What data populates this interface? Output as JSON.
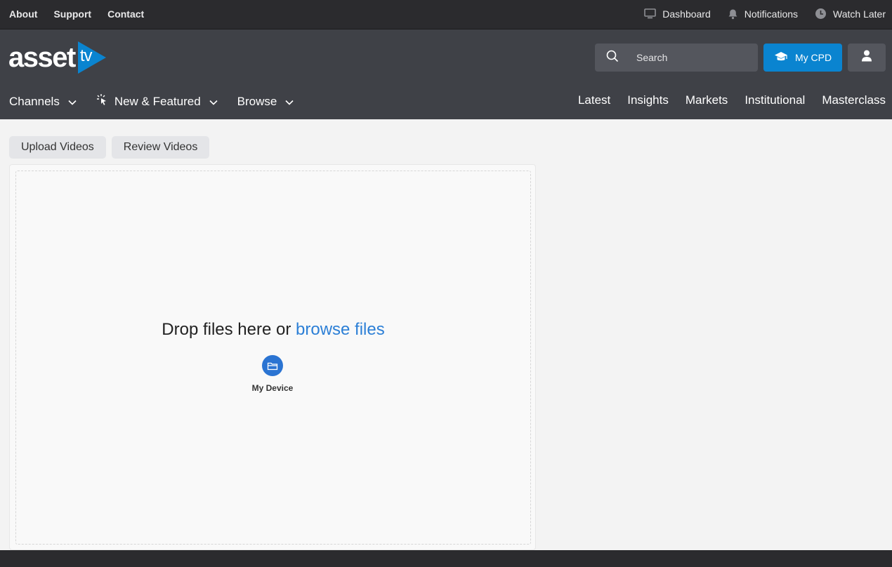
{
  "utility_nav": {
    "links": [
      {
        "label": "About"
      },
      {
        "label": "Support"
      },
      {
        "label": "Contact"
      }
    ],
    "right": [
      {
        "label": "Dashboard",
        "icon": "monitor-icon"
      },
      {
        "label": "Notifications",
        "icon": "bell-icon"
      },
      {
        "label": "Watch Later",
        "icon": "clock-icon"
      }
    ]
  },
  "header": {
    "logo_text": "asset",
    "logo_tv": "tv",
    "search": {
      "placeholder": "Search",
      "value": ""
    },
    "cpd_label": "My CPD",
    "colors": {
      "brand": "#0a84d0",
      "header_bg": "#3f4147",
      "utility_bg": "#2b2b2e"
    }
  },
  "main_nav": {
    "dropdowns": [
      {
        "label": "Channels"
      },
      {
        "label": "New & Featured"
      },
      {
        "label": "Browse"
      }
    ],
    "links": [
      {
        "label": "Latest"
      },
      {
        "label": "Insights"
      },
      {
        "label": "Markets"
      },
      {
        "label": "Institutional"
      },
      {
        "label": "Masterclass"
      }
    ]
  },
  "tabs": [
    {
      "label": "Upload Videos"
    },
    {
      "label": "Review Videos"
    }
  ],
  "uploader": {
    "drop_text": "Drop files here or",
    "browse_text": "browse files",
    "source_label": "My Device",
    "accent": "#2c7fd6"
  }
}
